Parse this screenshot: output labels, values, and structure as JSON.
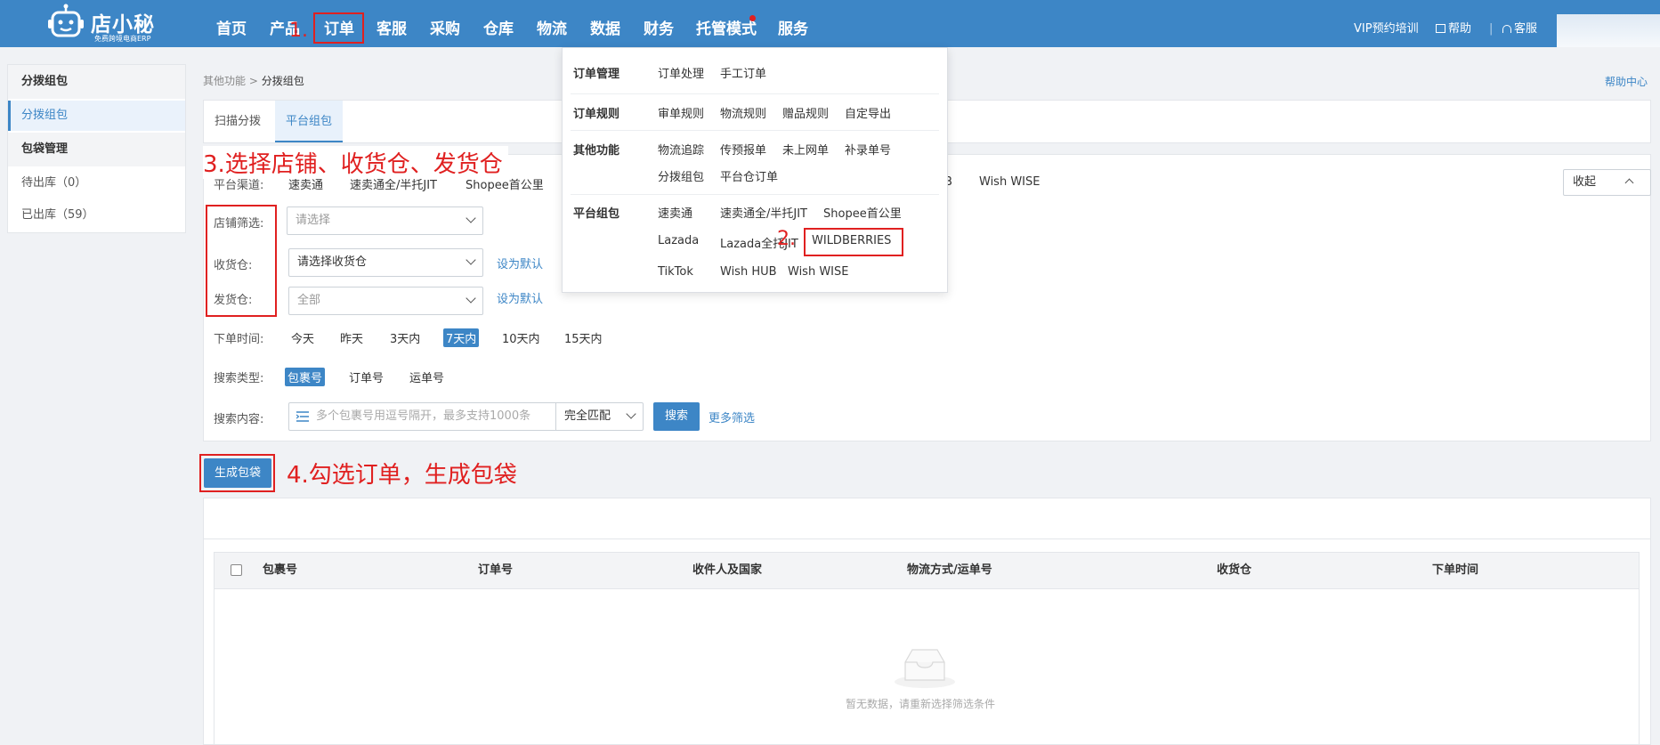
{
  "brand": {
    "name": "店小秘",
    "tagline": "免费跨境电商ERP"
  },
  "nav": {
    "items": [
      "首页",
      "产品",
      "订单",
      "客服",
      "采购",
      "仓库",
      "物流",
      "数据",
      "财务",
      "托管模式",
      "服务"
    ],
    "right": {
      "vip": "VIP预约培训",
      "help": "帮助",
      "service": "客服"
    }
  },
  "annotations": {
    "step1": "1.",
    "step2": "2.",
    "step3": "3.选择店铺、收货仓、发货仓",
    "step4": "4.勾选订单，生成包袋"
  },
  "sidebar": {
    "group1": "分拨组包",
    "group1_items": [
      "分拨组包"
    ],
    "group2": "包袋管理",
    "group2_items": [
      "待出库（0）",
      "已出库（59）"
    ]
  },
  "breadcrumb": {
    "parent": "其他功能",
    "sep": ">",
    "current": "分拨组包"
  },
  "help_center": "帮助中心",
  "tabs": [
    "扫描分拨",
    "平台组包"
  ],
  "filters": {
    "channel_label": "平台渠道:",
    "channels": [
      "速卖通",
      "速卖通全/半托JIT",
      "Shopee首公里",
      "B",
      "Wish WISE"
    ],
    "collapse": "收起",
    "shop_label": "店铺筛选:",
    "shop_placeholder": "请选择",
    "receive_label": "收货仓:",
    "receive_value": "请选择收货仓",
    "send_label": "发货仓:",
    "send_value": "全部",
    "set_default": "设为默认",
    "time_label": "下单时间:",
    "times": [
      "今天",
      "昨天",
      "3天内",
      "7天内",
      "10天内",
      "15天内"
    ],
    "time_selected": "7天内",
    "search_type_label": "搜索类型:",
    "search_types": [
      "包裹号",
      "订单号",
      "运单号"
    ],
    "search_type_selected": "包裹号",
    "search_content_label": "搜索内容:",
    "search_placeholder": "多个包裹号用逗号隔开，最多支持1000条",
    "match_mode": "完全匹配",
    "search_button": "搜索",
    "more_filters": "更多筛选"
  },
  "generate_button": "生成包袋",
  "table": {
    "columns": [
      "包裹号",
      "订单号",
      "收件人及国家",
      "物流方式/运单号",
      "收货仓",
      "下单时间"
    ],
    "empty_text": "暂无数据，请重新选择筛选条件"
  },
  "dropdown": {
    "sections": [
      {
        "title": "订单管理",
        "items": [
          "订单处理",
          "手工订单"
        ]
      },
      {
        "title": "订单规则",
        "items": [
          "审单规则",
          "物流规则",
          "赠品规则",
          "自定导出"
        ]
      },
      {
        "title": "其他功能",
        "items": [
          "物流追踪",
          "传预报单",
          "未上网单",
          "补录单号",
          "分拨组包",
          "平台仓订单"
        ]
      },
      {
        "title": "平台组包",
        "items": [
          "速卖通",
          "速卖通全/半托JIT",
          "Shopee首公里",
          "Lazada",
          "Lazada全托JIT",
          "WILDBERRIES",
          "TikTok",
          "Wish HUB",
          "Wish WISE"
        ]
      }
    ]
  },
  "colors": {
    "brand_blue": "#3d86c6",
    "annotation_red": "#e02020"
  }
}
